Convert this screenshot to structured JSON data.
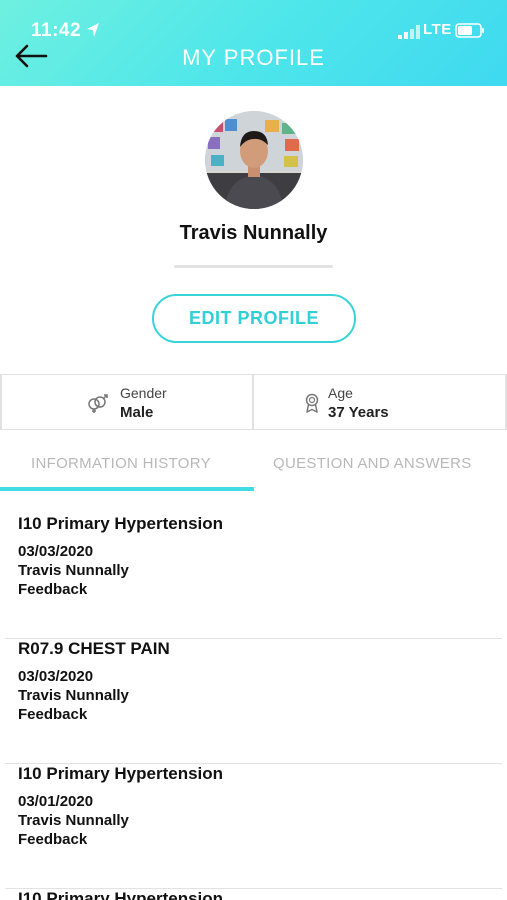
{
  "status_bar": {
    "time": "11:42",
    "network": "LTE"
  },
  "header": {
    "title": "MY PROFILE"
  },
  "profile": {
    "name": "Travis Nunnally",
    "edit_label": "EDIT PROFILE"
  },
  "stats": {
    "gender": {
      "label": "Gender",
      "value": "Male",
      "icon": "gender-icon"
    },
    "age": {
      "label": "Age",
      "value": "37 Years",
      "icon": "award-ribbon-icon"
    }
  },
  "tabs": [
    {
      "label": "INFORMATION HISTORY",
      "active": true
    },
    {
      "label": "QUESTION AND ANSWERS",
      "active": false
    }
  ],
  "history": [
    {
      "title": "I10 Primary Hypertension",
      "date": "03/03/2020",
      "author": "Travis Nunnally",
      "type": "Feedback"
    },
    {
      "title": "R07.9 CHEST PAIN",
      "date": "03/03/2020",
      "author": "Travis Nunnally",
      "type": "Feedback"
    },
    {
      "title": "I10 Primary Hypertension",
      "date": "03/01/2020",
      "author": "Travis Nunnally",
      "type": "Feedback"
    },
    {
      "title": "I10 Primary Hypertension"
    }
  ],
  "colors": {
    "accent": "#3fdde3",
    "header_gradient_start": "#6ef0e0",
    "header_gradient_end": "#3fd9f0"
  }
}
